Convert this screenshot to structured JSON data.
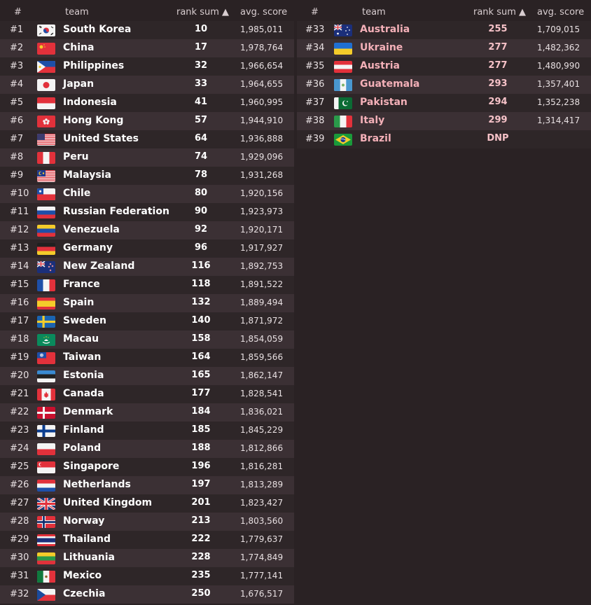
{
  "headers": {
    "rank": "#",
    "team": "team",
    "rank_sum": "rank sum ▲",
    "avg_score": "avg. score"
  },
  "flag_colors": {
    "red": "#e2313b",
    "white": "#f4f4f4",
    "blue": "#1e4fa8",
    "darkblue": "#1a2d6b",
    "yellow": "#f4cc2a",
    "green": "#2a9a4a",
    "black": "#202020",
    "orange": "#f08a24"
  },
  "rows": [
    {
      "rank": "#1",
      "flag": "south-korea",
      "team": "South Korea",
      "rank_sum": "10",
      "score": "1,985,011"
    },
    {
      "rank": "#2",
      "flag": "china",
      "team": "China",
      "rank_sum": "17",
      "score": "1,978,764"
    },
    {
      "rank": "#3",
      "flag": "philippines",
      "team": "Philippines",
      "rank_sum": "32",
      "score": "1,966,654"
    },
    {
      "rank": "#4",
      "flag": "japan",
      "team": "Japan",
      "rank_sum": "33",
      "score": "1,964,655"
    },
    {
      "rank": "#5",
      "flag": "indonesia",
      "team": "Indonesia",
      "rank_sum": "41",
      "score": "1,960,995"
    },
    {
      "rank": "#6",
      "flag": "hong-kong",
      "team": "Hong Kong",
      "rank_sum": "57",
      "score": "1,944,910"
    },
    {
      "rank": "#7",
      "flag": "united-states",
      "team": "United States",
      "rank_sum": "64",
      "score": "1,936,888"
    },
    {
      "rank": "#8",
      "flag": "peru",
      "team": "Peru",
      "rank_sum": "74",
      "score": "1,929,096"
    },
    {
      "rank": "#9",
      "flag": "malaysia",
      "team": "Malaysia",
      "rank_sum": "78",
      "score": "1,931,268"
    },
    {
      "rank": "#10",
      "flag": "chile",
      "team": "Chile",
      "rank_sum": "80",
      "score": "1,920,156"
    },
    {
      "rank": "#11",
      "flag": "russia",
      "team": "Russian Federation",
      "rank_sum": "90",
      "score": "1,923,973"
    },
    {
      "rank": "#12",
      "flag": "venezuela",
      "team": "Venezuela",
      "rank_sum": "92",
      "score": "1,920,171"
    },
    {
      "rank": "#13",
      "flag": "germany",
      "team": "Germany",
      "rank_sum": "96",
      "score": "1,917,927"
    },
    {
      "rank": "#14",
      "flag": "new-zealand",
      "team": "New Zealand",
      "rank_sum": "116",
      "score": "1,892,753"
    },
    {
      "rank": "#15",
      "flag": "france",
      "team": "France",
      "rank_sum": "118",
      "score": "1,891,522"
    },
    {
      "rank": "#16",
      "flag": "spain",
      "team": "Spain",
      "rank_sum": "132",
      "score": "1,889,494"
    },
    {
      "rank": "#17",
      "flag": "sweden",
      "team": "Sweden",
      "rank_sum": "140",
      "score": "1,871,972"
    },
    {
      "rank": "#18",
      "flag": "macau",
      "team": "Macau",
      "rank_sum": "158",
      "score": "1,854,059"
    },
    {
      "rank": "#19",
      "flag": "taiwan",
      "team": "Taiwan",
      "rank_sum": "164",
      "score": "1,859,566"
    },
    {
      "rank": "#20",
      "flag": "estonia",
      "team": "Estonia",
      "rank_sum": "165",
      "score": "1,862,147"
    },
    {
      "rank": "#21",
      "flag": "canada",
      "team": "Canada",
      "rank_sum": "177",
      "score": "1,828,541"
    },
    {
      "rank": "#22",
      "flag": "denmark",
      "team": "Denmark",
      "rank_sum": "184",
      "score": "1,836,021"
    },
    {
      "rank": "#23",
      "flag": "finland",
      "team": "Finland",
      "rank_sum": "185",
      "score": "1,845,229"
    },
    {
      "rank": "#24",
      "flag": "poland",
      "team": "Poland",
      "rank_sum": "188",
      "score": "1,812,866"
    },
    {
      "rank": "#25",
      "flag": "singapore",
      "team": "Singapore",
      "rank_sum": "196",
      "score": "1,816,281"
    },
    {
      "rank": "#26",
      "flag": "netherlands",
      "team": "Netherlands",
      "rank_sum": "197",
      "score": "1,813,289"
    },
    {
      "rank": "#27",
      "flag": "united-kingdom",
      "team": "United Kingdom",
      "rank_sum": "201",
      "score": "1,823,427"
    },
    {
      "rank": "#28",
      "flag": "norway",
      "team": "Norway",
      "rank_sum": "213",
      "score": "1,803,560"
    },
    {
      "rank": "#29",
      "flag": "thailand",
      "team": "Thailand",
      "rank_sum": "222",
      "score": "1,779,637"
    },
    {
      "rank": "#30",
      "flag": "lithuania",
      "team": "Lithuania",
      "rank_sum": "228",
      "score": "1,774,849"
    },
    {
      "rank": "#31",
      "flag": "mexico",
      "team": "Mexico",
      "rank_sum": "235",
      "score": "1,777,141"
    },
    {
      "rank": "#32",
      "flag": "czechia",
      "team": "Czechia",
      "rank_sum": "250",
      "score": "1,676,517"
    },
    {
      "rank": "#33",
      "flag": "australia",
      "team": "Australia",
      "rank_sum": "255",
      "score": "1,709,015"
    },
    {
      "rank": "#34",
      "flag": "ukraine",
      "team": "Ukraine",
      "rank_sum": "277",
      "score": "1,482,362"
    },
    {
      "rank": "#35",
      "flag": "austria",
      "team": "Austria",
      "rank_sum": "277",
      "score": "1,480,990"
    },
    {
      "rank": "#36",
      "flag": "guatemala",
      "team": "Guatemala",
      "rank_sum": "293",
      "score": "1,357,401"
    },
    {
      "rank": "#37",
      "flag": "pakistan",
      "team": "Pakistan",
      "rank_sum": "294",
      "score": "1,352,238"
    },
    {
      "rank": "#38",
      "flag": "italy",
      "team": "Italy",
      "rank_sum": "299",
      "score": "1,314,417"
    },
    {
      "rank": "#39",
      "flag": "brazil",
      "team": "Brazil",
      "rank_sum": "DNP",
      "score": ""
    }
  ]
}
